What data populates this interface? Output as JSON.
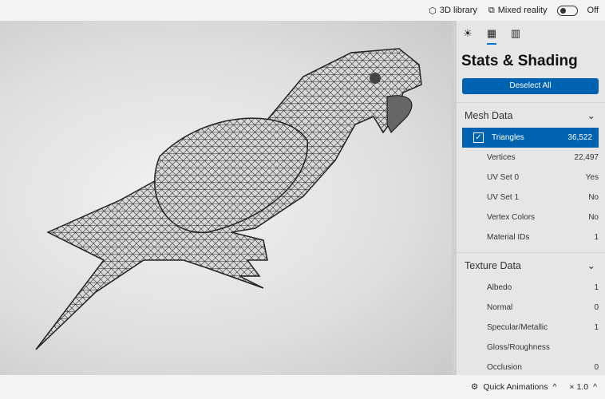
{
  "topbar": {
    "library": "3D library",
    "mixed_reality": "Mixed reality",
    "toggle_state": "Off"
  },
  "panel": {
    "tabs": [
      "lighting-icon",
      "stats-icon",
      "grid-icon"
    ],
    "active_tab": 1,
    "title": "Stats & Shading",
    "deselect": "Deselect All",
    "mesh": {
      "title": "Mesh Data",
      "rows": [
        {
          "label": "Triangles",
          "value": "36,522",
          "selected": true
        },
        {
          "label": "Vertices",
          "value": "22,497"
        },
        {
          "label": "UV Set 0",
          "value": "Yes"
        },
        {
          "label": "UV Set 1",
          "value": "No"
        },
        {
          "label": "Vertex Colors",
          "value": "No"
        },
        {
          "label": "Material IDs",
          "value": "1"
        }
      ]
    },
    "texture": {
      "title": "Texture Data",
      "rows": [
        {
          "label": "Albedo",
          "value": "1"
        },
        {
          "label": "Normal",
          "value": "0"
        },
        {
          "label": "Specular/Metallic",
          "value": "1"
        },
        {
          "label": "Gloss/Roughness",
          "value": ""
        },
        {
          "label": "Occlusion",
          "value": "0"
        }
      ]
    }
  },
  "bottombar": {
    "quick_animations": "Quick Animations",
    "speed": "× 1.0"
  },
  "colors": {
    "accent": "#0063b1"
  }
}
